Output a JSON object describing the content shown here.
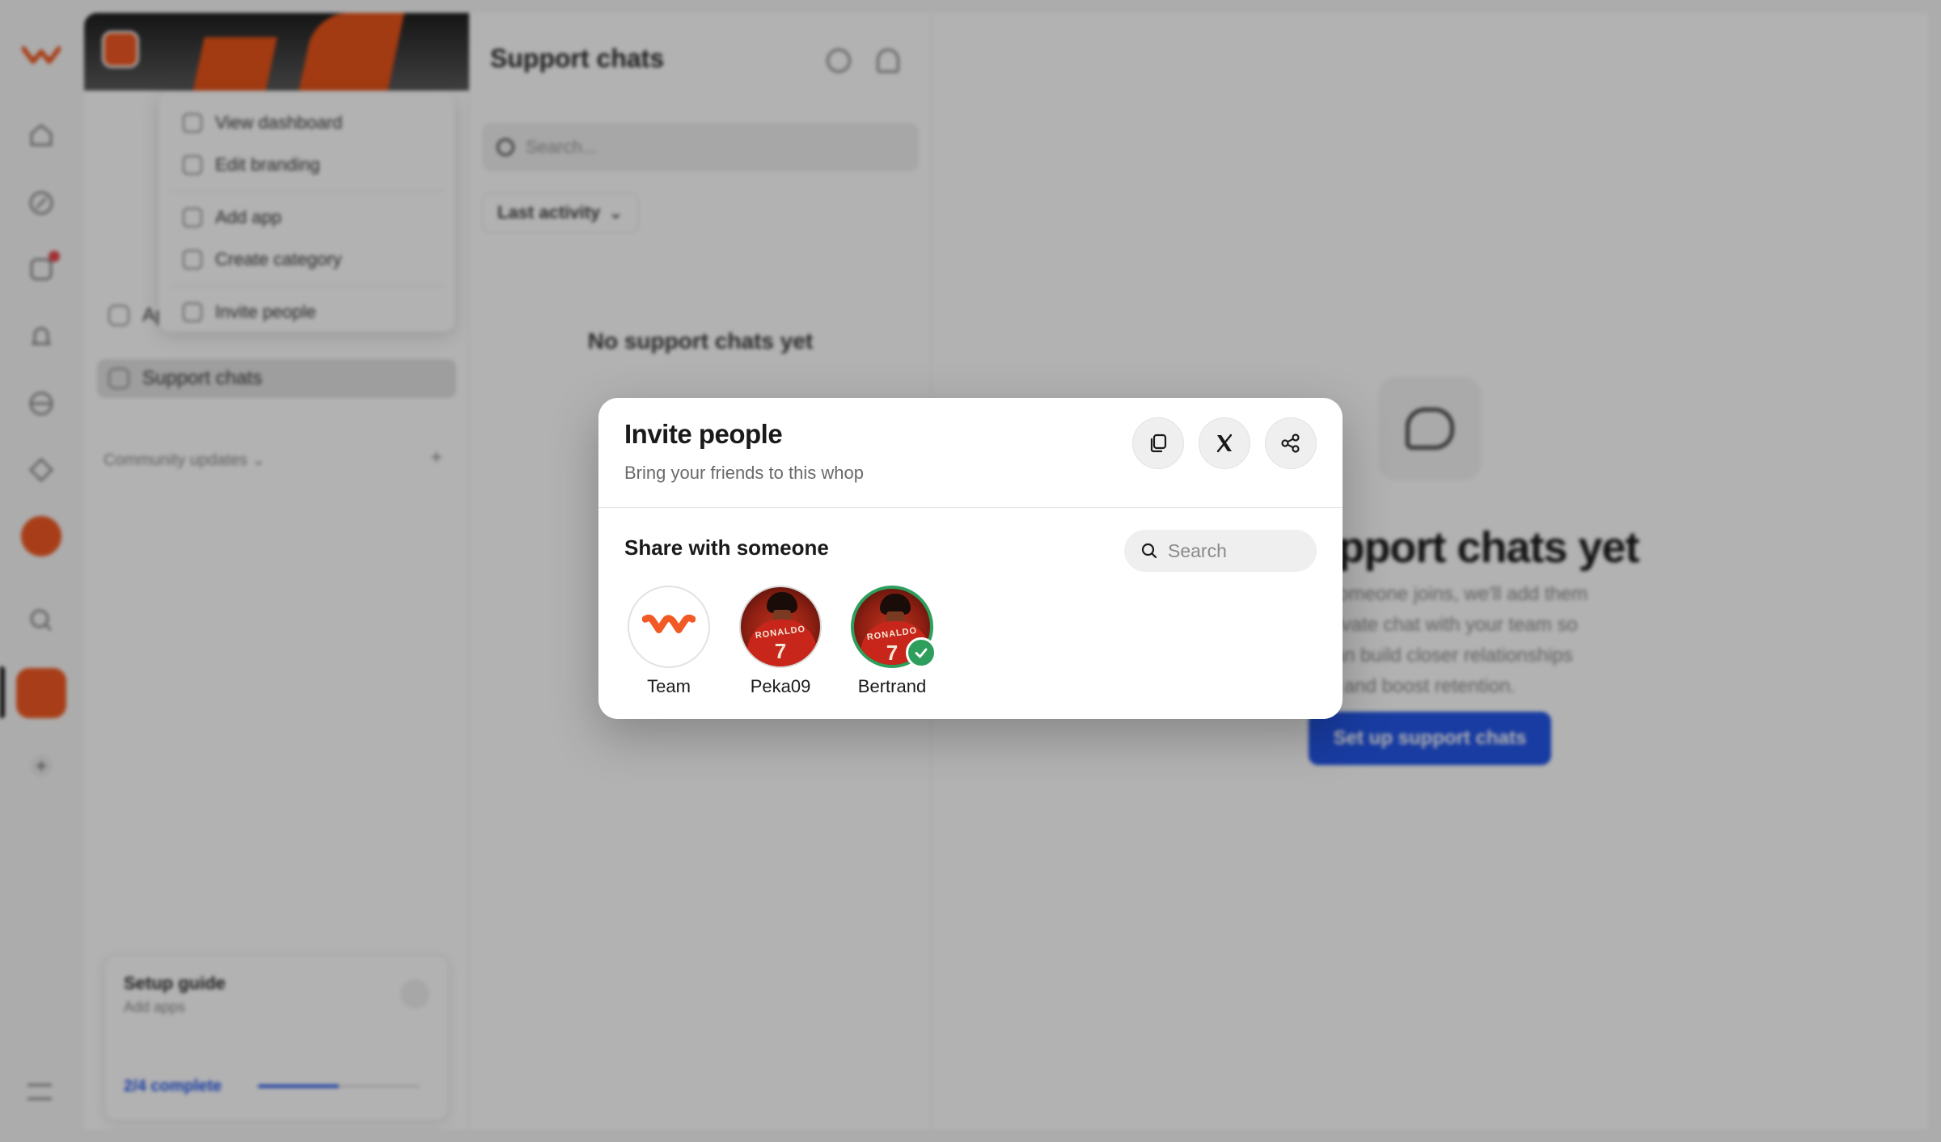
{
  "background": {
    "panel": {
      "menu": [
        "View dashboard",
        "Edit branding",
        "Add app",
        "Create category",
        "Invite people"
      ],
      "nav": [
        "App store",
        "Support chats"
      ],
      "community_label": "Community updates",
      "setup_title": "Setup guide",
      "setup_sub": "Add apps",
      "setup_progress": "2/4 complete",
      "setup_progress_value": 0.5
    },
    "list": {
      "title": "Support chats",
      "search_placeholder": "Search...",
      "filter": "Last activity",
      "empty": "No support chats yet"
    },
    "main": {
      "title": "No support chats yet",
      "description": "When someone joins, we'll add them to a private chat with your team so you can build closer relationships and boost retention.",
      "button": "Set up support chats"
    }
  },
  "modal": {
    "title": "Invite people",
    "subtitle": "Bring your friends to this whop",
    "actions": [
      "copy-link-icon",
      "x-logo-icon",
      "share-icon"
    ],
    "share_title": "Share with someone",
    "search_placeholder": "Search",
    "people": [
      {
        "name": "Team",
        "avatar": "whop-logo",
        "selected": false
      },
      {
        "name": "Peka09",
        "avatar": "photo-jersey",
        "jersey_name": "RONALDO",
        "jersey_number": "7",
        "selected": false
      },
      {
        "name": "Bertrand",
        "avatar": "photo-jersey",
        "jersey_name": "RONALDO",
        "jersey_number": "7",
        "selected": true
      }
    ]
  },
  "colors": {
    "accent_orange": "#f15a24",
    "primary_blue": "#2356e8",
    "selected_green": "#2e9e5c"
  }
}
